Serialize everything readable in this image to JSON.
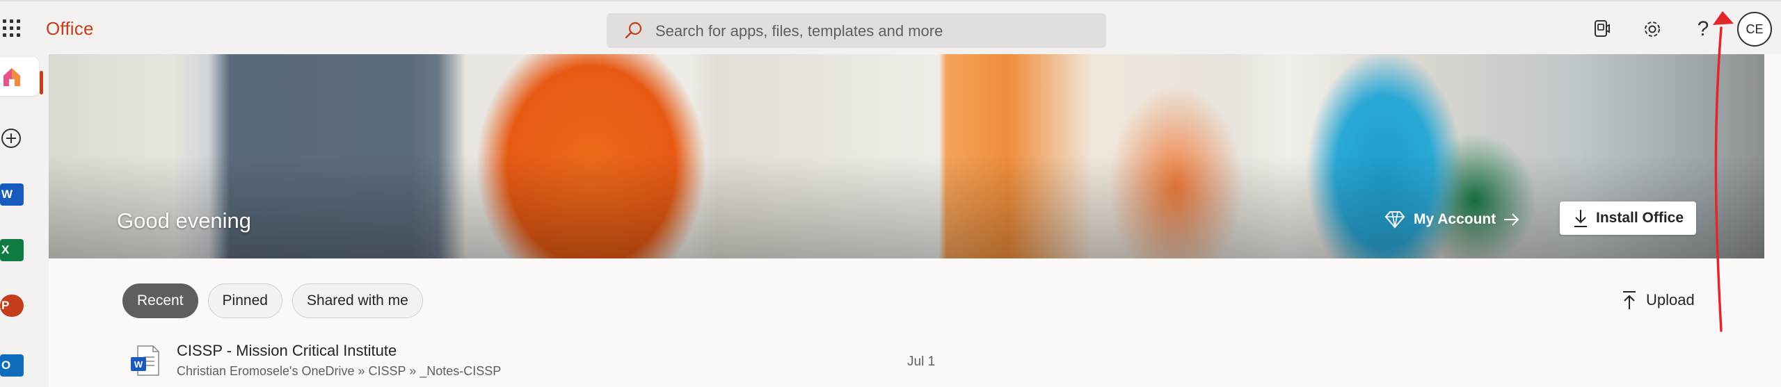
{
  "header": {
    "brand": "Office",
    "search_placeholder": "Search for apps, files, templates and more",
    "avatar_initials": "CE",
    "help_glyph": "?",
    "icons": [
      "app-launcher-icon",
      "search-icon",
      "feedback-icon",
      "gear-icon",
      "help-icon"
    ]
  },
  "rail": {
    "items": [
      {
        "name": "home",
        "icon": "home-icon",
        "active": true
      },
      {
        "name": "create",
        "icon": "plus-circle-icon"
      },
      {
        "name": "word",
        "icon": "word-icon",
        "letter": "W",
        "color": "#185abd"
      },
      {
        "name": "excel",
        "icon": "excel-icon",
        "letter": "X",
        "color": "#107c41"
      },
      {
        "name": "powerpoint",
        "icon": "powerpoint-icon",
        "letter": "P",
        "color": "#c43e1c"
      },
      {
        "name": "outlook",
        "icon": "outlook-icon",
        "letter": "O",
        "color": "#0f6cbd"
      }
    ]
  },
  "hero": {
    "greeting": "Good evening",
    "my_account": "My Account",
    "install_office": "Install Office"
  },
  "tabs": [
    {
      "label": "Recent",
      "active": true
    },
    {
      "label": "Pinned",
      "active": false
    },
    {
      "label": "Shared with me",
      "active": false
    }
  ],
  "upload_label": "Upload",
  "files": [
    {
      "name": "CISSP - Mission Critical Institute",
      "path": "Christian Eromosele's OneDrive » CISSP » _Notes-CISSP",
      "date": "Jul 1",
      "type": "word"
    }
  ],
  "colors": {
    "brand": "#c43e1c",
    "annotation_arrow": "#e3262b",
    "active_tab": "#605e5c"
  }
}
